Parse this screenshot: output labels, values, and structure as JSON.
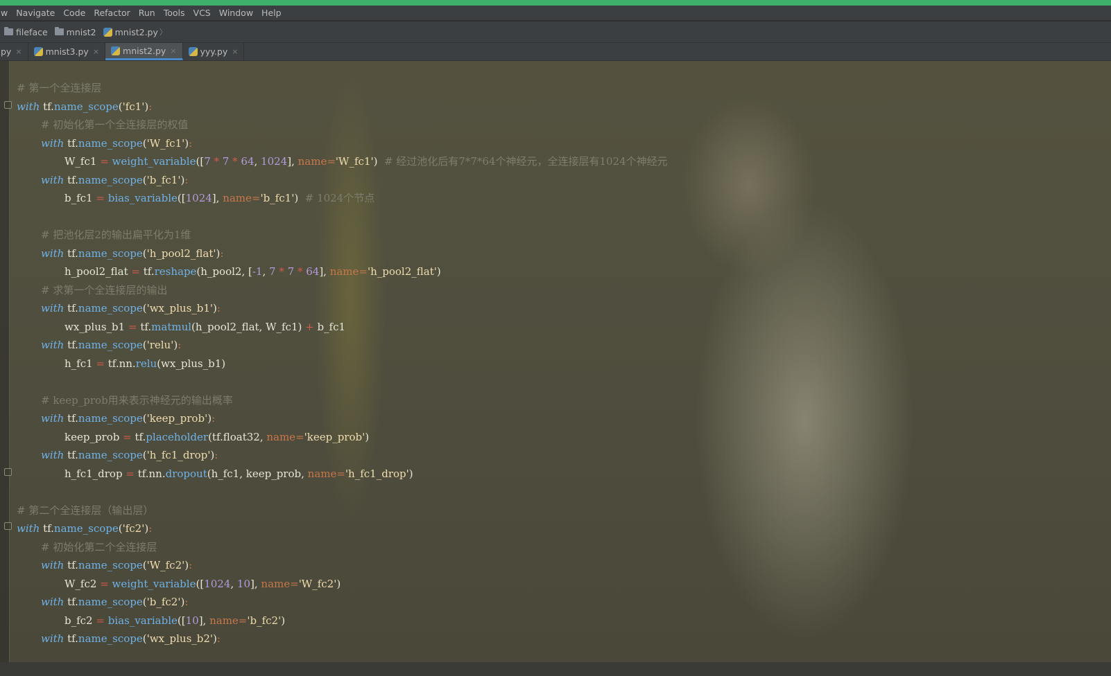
{
  "menu": [
    "w",
    "Navigate",
    "Code",
    "Refactor",
    "Run",
    "Tools",
    "VCS",
    "Window",
    "Help"
  ],
  "breadcrumb": [
    "fileface",
    "mnist2",
    "mnist2.py"
  ],
  "tabs": [
    {
      "label": "py",
      "active": false
    },
    {
      "label": "mnist3.py",
      "active": false
    },
    {
      "label": "mnist2.py",
      "active": true
    },
    {
      "label": "yyy.py",
      "active": false
    }
  ],
  "tab_close_glyph": "×",
  "code": {
    "c1": "# 第一个全连接层",
    "c2": "# 初始化第一个全连接层的权值",
    "c3": "# 经过池化后有7*7*64个神经元，全连接层有1024个神经元",
    "c4": "# 1024个节点",
    "c5": "# 把池化层2的输出扁平化为1维",
    "c6": "# 求第一个全连接层的输出",
    "c7": "# keep_prob用来表示神经元的输出概率",
    "c8": "# 第二个全连接层（输出层）",
    "c9": "# 初始化第二个全连接层",
    "scope_fc1": "'fc1'",
    "scope_W_fc1": "'W_fc1'",
    "scope_b_fc1": "'b_fc1'",
    "scope_h_pool2_flat": "'h_pool2_flat'",
    "scope_wx_plus_b1": "'wx_plus_b1'",
    "scope_relu": "'relu'",
    "scope_keep_prob": "'keep_prob'",
    "scope_h_fc1_drop": "'h_fc1_drop'",
    "scope_fc2": "'fc2'",
    "scope_W_fc2": "'W_fc2'",
    "scope_b_fc2": "'b_fc2'",
    "scope_wx_plus_b2": "'wx_plus_b2'",
    "n_7": "7",
    "n_64": "64",
    "n_1024": "1024",
    "n_neg1": "-1",
    "n_10": "10"
  },
  "colors": {
    "keyword": "#6fb2e8",
    "string": "#f0ddb0",
    "number": "#b39bdc",
    "comment": "#7e7c6c",
    "operator": "#d25a4a",
    "titlebar": "#3fb06b"
  }
}
